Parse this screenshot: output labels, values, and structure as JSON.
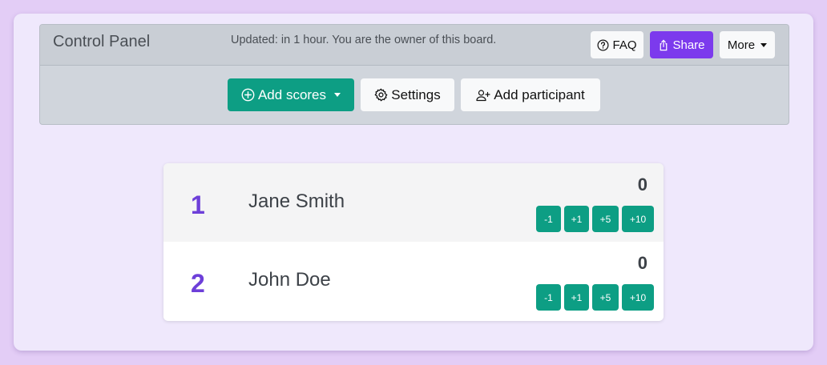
{
  "header": {
    "title": "Control Panel",
    "status": "Updated: in 1 hour. You are the owner of this board.",
    "faq_label": "FAQ",
    "share_label": "Share",
    "more_label": "More"
  },
  "toolbar": {
    "add_scores_label": "Add scores",
    "settings_label": "Settings",
    "add_participant_label": "Add participant"
  },
  "participants": [
    {
      "rank": "1",
      "name": "Jane Smith",
      "score": "0"
    },
    {
      "rank": "2",
      "name": "John Doe",
      "score": "0"
    }
  ],
  "score_buttons": [
    "-1",
    "+1",
    "+5",
    "+10"
  ],
  "colors": {
    "background": "#e3cdf6",
    "card": "#efe8fc",
    "share_accent": "#7c3aed",
    "primary_green": "#0d9e84",
    "rank_purple": "#6d3fd9"
  },
  "icons": {
    "faq": "question-circle-icon",
    "share": "share-icon",
    "add_scores": "plus-circle-icon",
    "settings": "gear-icon",
    "add_participant": "person-plus-icon"
  }
}
